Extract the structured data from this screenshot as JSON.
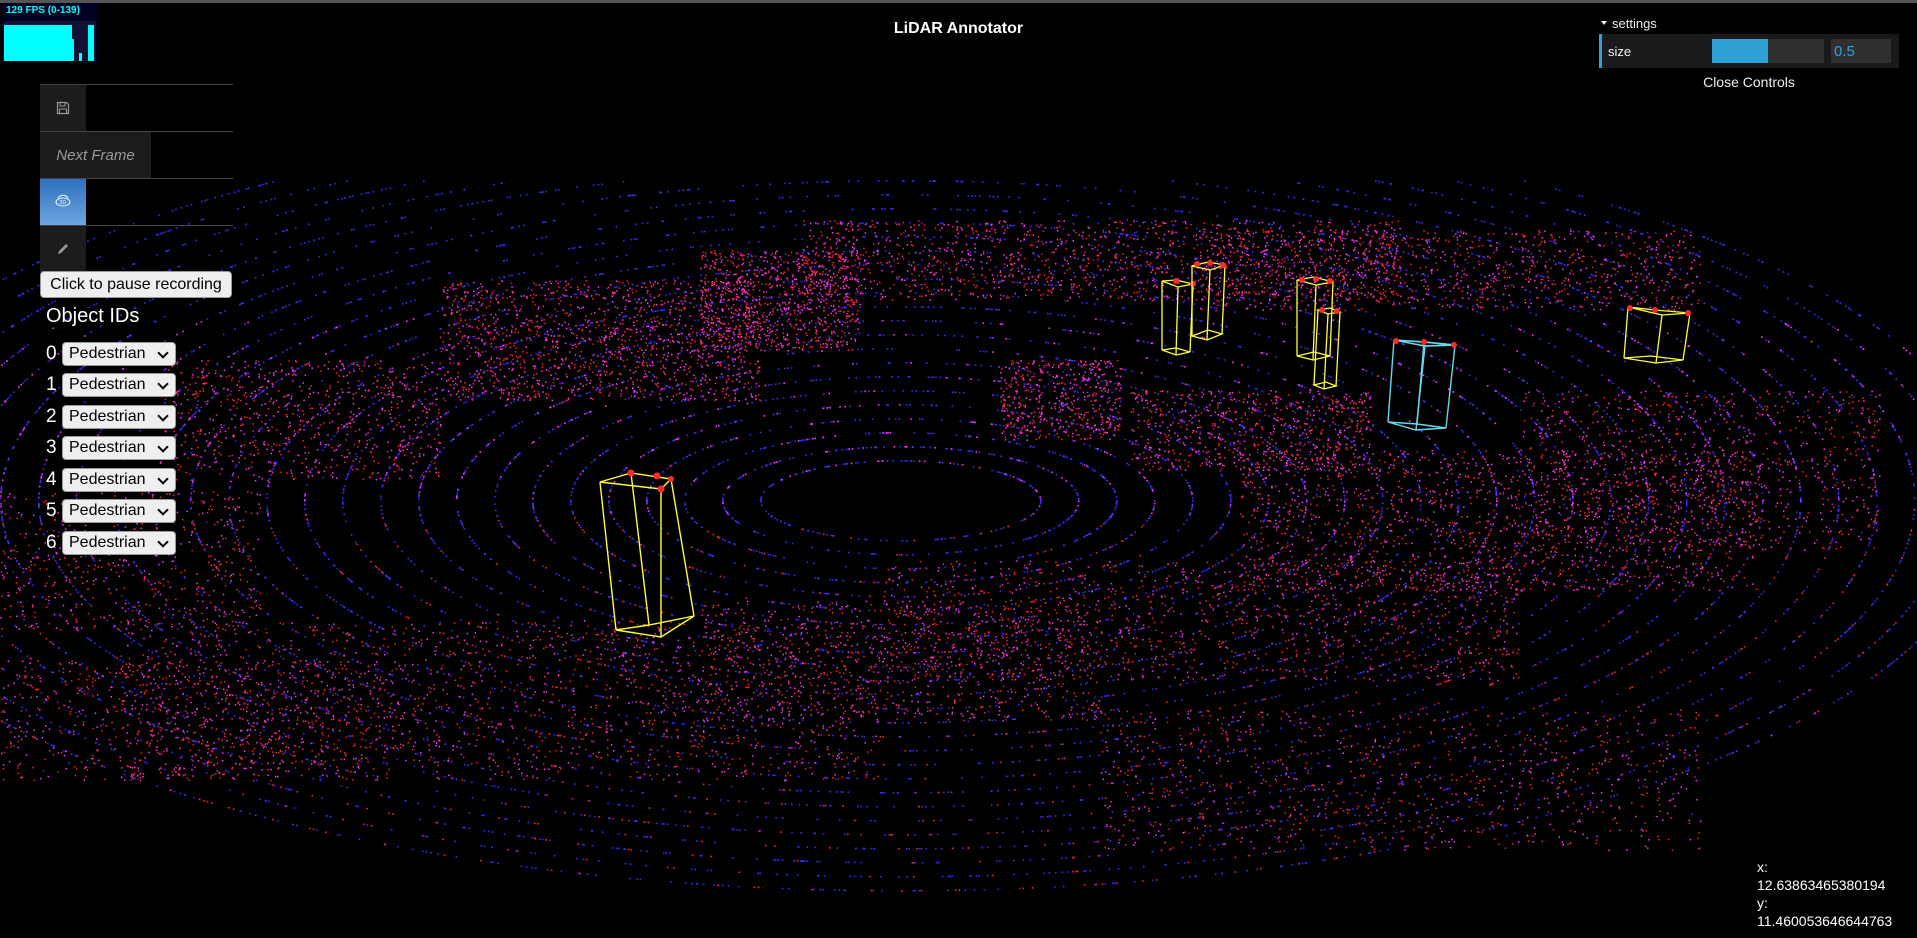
{
  "app": {
    "title": "LiDAR Annotator"
  },
  "stats": {
    "fps_text": "129 FPS (0-139)"
  },
  "toolbar": {
    "save_icon": "floppy-disk-icon",
    "next_frame_label": "Next Frame",
    "view_icon": "3d-rotate-icon",
    "edit_icon": "pencil-icon"
  },
  "recording": {
    "button_label": "Click to pause recording"
  },
  "objects": {
    "title": "Object IDs",
    "items": [
      {
        "id": "0",
        "label": "Pedestrian"
      },
      {
        "id": "1",
        "label": "Pedestrian"
      },
      {
        "id": "2",
        "label": "Pedestrian"
      },
      {
        "id": "3",
        "label": "Pedestrian"
      },
      {
        "id": "4",
        "label": "Pedestrian"
      },
      {
        "id": "5",
        "label": "Pedestrian"
      },
      {
        "id": "6",
        "label": "Pedestrian"
      }
    ]
  },
  "settings": {
    "folder_label": "settings",
    "size_label": "size",
    "size_value": "0.5",
    "size_fraction": 0.5,
    "close_label": "Close Controls"
  },
  "cursor": {
    "x_label": "x:",
    "x_value": "12.63863465380194",
    "y_label": "y:",
    "y_value": "11.460053646644763"
  },
  "colors": {
    "accent": "#2fa1d6",
    "box_default": "#ffff33",
    "box_selected": "#66d9ee",
    "corner": "#ff2a2a",
    "points_near": "#3a2aff",
    "points_mid": "#ff33ff",
    "points_far": "#ff2020"
  }
}
